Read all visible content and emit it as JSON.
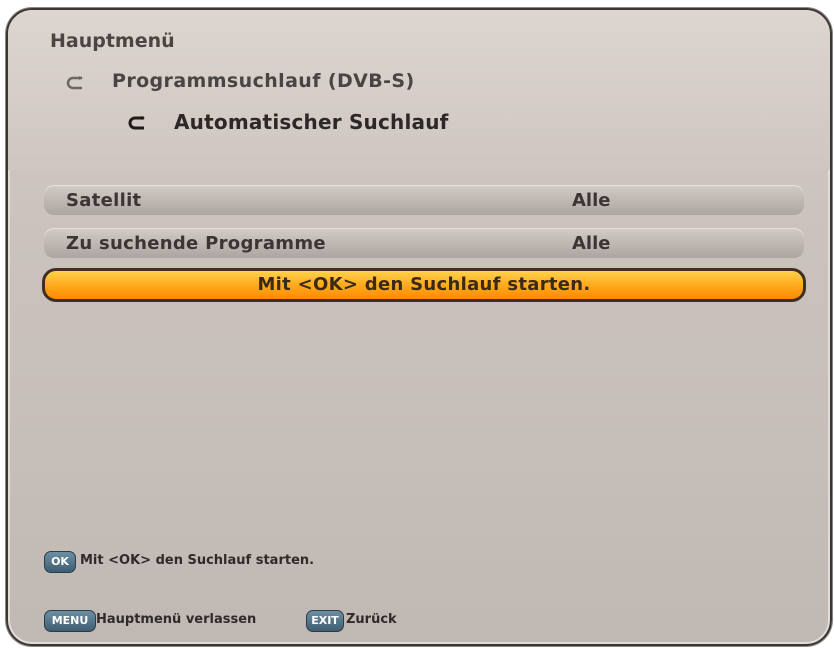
{
  "breadcrumb": {
    "main": "Hauptmenü",
    "level1": "Programmsuchlauf (DVB-S)",
    "level2": "Automatischer Suchlauf"
  },
  "settings": [
    {
      "label": "Satellit",
      "value": "Alle"
    },
    {
      "label": "Zu suchende Programme",
      "value": "Alle"
    }
  ],
  "action": {
    "label": "Mit <OK> den Suchlauf starten."
  },
  "footer": {
    "ok_key": "OK",
    "ok_hint": "Mit <OK> den Suchlauf starten.",
    "menu_key": "MENU",
    "menu_hint": "Hauptmenü verlassen",
    "exit_key": "EXIT",
    "exit_hint": "Zurück"
  },
  "colors": {
    "highlight": "#ffae22",
    "panel": "#cbc2bd",
    "key": "#4f7085"
  }
}
